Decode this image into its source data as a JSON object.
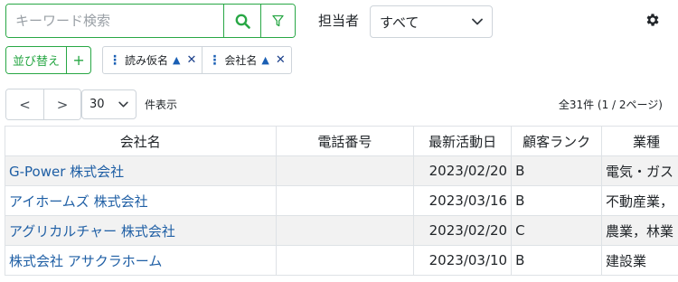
{
  "search": {
    "placeholder": "キーワード検索",
    "value": ""
  },
  "owner": {
    "label": "担当者",
    "selected": "すべて"
  },
  "sort": {
    "button_label": "並び替え",
    "add_label": "+",
    "chips": [
      {
        "label": "読み仮名",
        "direction": "▲"
      },
      {
        "label": "会社名",
        "direction": "▲"
      }
    ]
  },
  "pager": {
    "prev": "<",
    "next": ">",
    "per_page": "30",
    "per_page_label": "件表示",
    "total": "全31件 (1 / 2ページ)"
  },
  "table": {
    "headers": [
      "会社名",
      "電話番号",
      "最新活動日",
      "顧客ランク",
      "業種"
    ],
    "rows": [
      {
        "company": "G-Power 株式会社",
        "phone": "",
        "date": "2023/02/20",
        "rank": "B",
        "industry": "電気・ガス"
      },
      {
        "company": "アイホームズ 株式会社",
        "phone": "",
        "date": "2023/03/16",
        "rank": "B",
        "industry": "不動産業，"
      },
      {
        "company": "アグリカルチャー 株式会社",
        "phone": "",
        "date": "2023/02/20",
        "rank": "C",
        "industry": "農業，林業"
      },
      {
        "company": "株式会社 アサクラホーム",
        "phone": "",
        "date": "2023/03/10",
        "rank": "B",
        "industry": "建設業"
      }
    ]
  },
  "colors": {
    "accent": "#28a745",
    "link": "#1f5fa5",
    "chip_icon": "#1a5fb4"
  },
  "icons": {
    "search": "search-icon",
    "filter": "filter-icon",
    "settings": "gear-icon",
    "dropdown": "chevron-down-icon"
  }
}
